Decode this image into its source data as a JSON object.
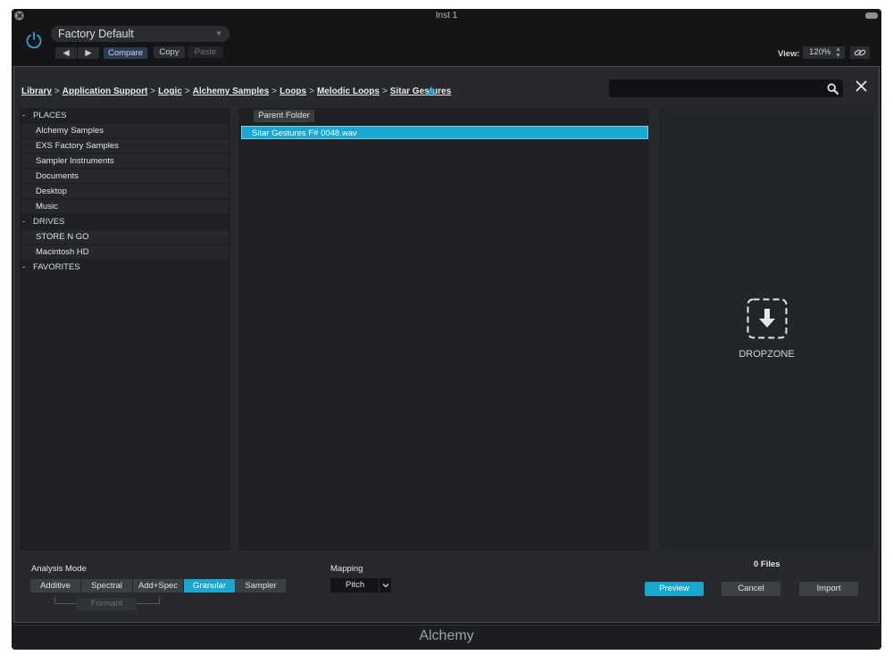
{
  "window": {
    "title": "Inst 1"
  },
  "header": {
    "preset_name": "Factory Default",
    "prev_label": "◀",
    "next_label": "▶",
    "compare_label": "Compare",
    "copy_label": "Copy",
    "paste_label": "Paste",
    "view_label": "View:",
    "view_value": "120%",
    "icons": {
      "power": "power-icon",
      "link": "link-icon",
      "preset_arrow": "chevron-down-icon"
    }
  },
  "browser": {
    "breadcrumb": [
      "Library",
      "Application Support",
      "Logic",
      "Alchemy Samples",
      "Loops",
      "Melodic Loops",
      "Sitar Gestures"
    ],
    "breadcrumb_separator": ">",
    "search": {
      "value": "",
      "placeholder": ""
    },
    "sidebar": {
      "places_header": "PLACES",
      "places": [
        "Alchemy Samples",
        "EXS Factory Samples",
        "Sampler Instruments",
        "Documents",
        "Desktop",
        "Music"
      ],
      "drives_header": "DRIVES",
      "drives": [
        "STORE N GO",
        "Macintosh HD"
      ],
      "favorites_header": "FAVORITES",
      "collapse_symbol": "-"
    },
    "filelist": {
      "parent_folder_label": "Parent Folder",
      "files": [
        "Sitar Gestures F# 0048.wav"
      ]
    },
    "dropzone_label": "DROPZONE"
  },
  "bottom": {
    "analysis_mode_label": "Analysis Mode",
    "modes": [
      "Additive",
      "Spectral",
      "Add+Spec",
      "Granular",
      "Sampler"
    ],
    "active_mode": "Granular",
    "formant_label": "Formant",
    "mapping_label": "Mapping",
    "mapping_value": "Pitch",
    "files_count": "0 Files",
    "preview_label": "Preview",
    "cancel_label": "Cancel",
    "import_label": "Import"
  },
  "footer": {
    "title": "Alchemy"
  },
  "colors": {
    "accent": "#19a6cf",
    "window_bg": "#1a1b1d",
    "panel_bg": "#27292d",
    "power_blue": "#3d9bd8"
  }
}
